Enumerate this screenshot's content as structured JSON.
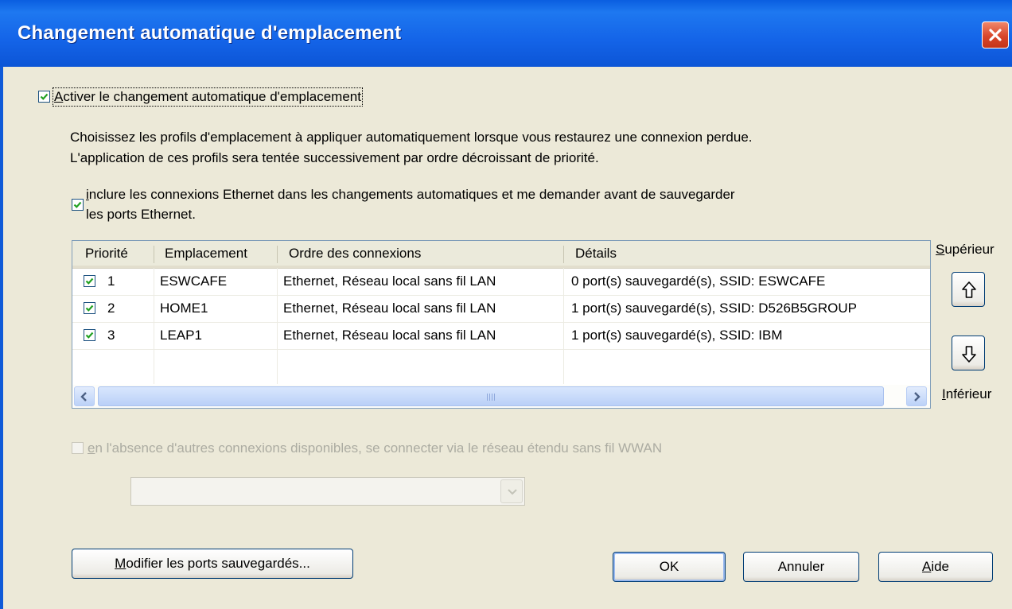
{
  "window": {
    "title": "Changement automatique d'emplacement"
  },
  "enable_switching": {
    "checked": true,
    "access_key": "A",
    "label_rest": "ctiver le changement automatique d'emplacement"
  },
  "description": {
    "line1": "Choisissez les profils d'emplacement à appliquer automatiquement lorsque vous restaurez une connexion perdue.",
    "line2": "L'application de ces profils sera tentée successivement par ordre décroissant de priorité."
  },
  "include_ethernet": {
    "checked": true,
    "access_key": "i",
    "label_line1_rest": "nclure les connexions Ethernet dans les changements automatiques et me demander avant de sauvegarder",
    "label_line2": "les ports Ethernet."
  },
  "table": {
    "columns": [
      "Priorité",
      "Emplacement",
      "Ordre des connexions",
      "Détails"
    ],
    "rows": [
      {
        "checked": true,
        "priority": "1",
        "location": "ESWCAFE",
        "order": "Ethernet, Réseau local sans fil LAN",
        "details": "0 port(s) sauvegardé(s),  SSID: ESWCAFE"
      },
      {
        "checked": true,
        "priority": "2",
        "location": "HOME1",
        "order": "Ethernet, Réseau local sans fil LAN",
        "details": "1 port(s) sauvegardé(s),  SSID: D526B5GROUP"
      },
      {
        "checked": true,
        "priority": "3",
        "location": "LEAP1",
        "order": "Ethernet, Réseau local sans fil LAN",
        "details": "1 port(s) sauvegardé(s),  SSID: IBM"
      }
    ]
  },
  "priority_up": {
    "access_key": "S",
    "label_rest": "upérieur"
  },
  "priority_down": {
    "access_key": "I",
    "label_rest": "nférieur"
  },
  "wwan": {
    "checked": false,
    "enabled": false,
    "access_key": "e",
    "label_rest": "n l'absence d'autres connexions disponibles, se connecter via le réseau étendu sans fil WWAN",
    "select_value": ""
  },
  "buttons": {
    "modify_access_key": "M",
    "modify_rest": "odifier les ports sauvegardés...",
    "ok": "OK",
    "cancel": "Annuler",
    "help_access_key": "A",
    "help_rest": "ide"
  },
  "colors": {
    "titlebar": "#0a5ee0",
    "dialog_background": "#ece9d8",
    "checkmark": "#21a121",
    "close_button": "#d8462a"
  }
}
